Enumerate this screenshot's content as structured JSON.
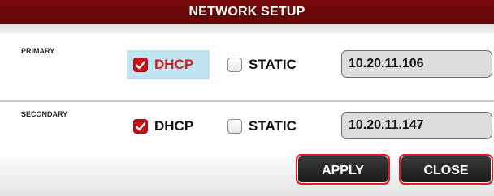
{
  "dialog": {
    "title": "NETWORK SETUP",
    "primary": {
      "label": "PRIMARY",
      "dhcp": {
        "label": "DHCP",
        "checked": true
      },
      "static": {
        "label": "STATIC",
        "checked": false
      },
      "ip": "10.20.11.106"
    },
    "secondary": {
      "label": "SECONDARY",
      "dhcp": {
        "label": "DHCP",
        "checked": true
      },
      "static": {
        "label": "STATIC",
        "checked": false
      },
      "ip": "10.20.11.147"
    },
    "buttons": {
      "apply": "APPLY",
      "close": "CLOSE"
    }
  },
  "colors": {
    "title_bg": "#6b0808",
    "accent_red": "#c5121b",
    "focus_highlight": "#bfe4ef"
  }
}
